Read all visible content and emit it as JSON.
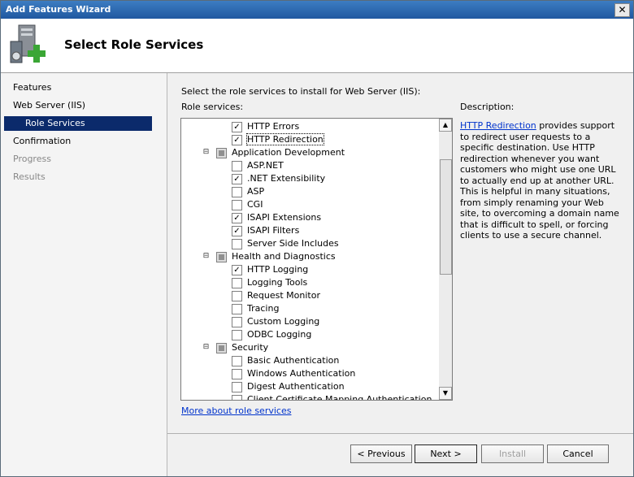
{
  "window": {
    "title": "Add Features Wizard",
    "close_label": "✕"
  },
  "header": {
    "title": "Select Role Services"
  },
  "nav": {
    "items": [
      {
        "label": "Features"
      },
      {
        "label": "Web Server (IIS)"
      },
      {
        "label": "Role Services"
      },
      {
        "label": "Confirmation"
      },
      {
        "label": "Progress"
      },
      {
        "label": "Results"
      }
    ]
  },
  "main": {
    "instruction": "Select the role services to install for Web Server (IIS):",
    "role_services_label": "Role services:",
    "description_label": "Description:",
    "description_link": "HTTP Redirection",
    "description_text": " provides support to redirect user requests to a specific destination. Use HTTP redirection whenever you want customers who might use one URL to actually end up at another URL. This is helpful in many situations, from simply renaming your Web site, to overcoming a domain name that is difficult to spell, or forcing clients to use a secure channel.",
    "more_link": "More about role services"
  },
  "tree": {
    "items": [
      {
        "label": "HTTP Errors",
        "checked": true
      },
      {
        "label": "HTTP Redirection",
        "checked": true
      },
      {
        "label": "Application Development",
        "group": true
      },
      {
        "label": "ASP.NET",
        "checked": false
      },
      {
        "label": ".NET Extensibility",
        "checked": true
      },
      {
        "label": "ASP",
        "checked": false
      },
      {
        "label": "CGI",
        "checked": false
      },
      {
        "label": "ISAPI Extensions",
        "checked": true
      },
      {
        "label": "ISAPI Filters",
        "checked": true
      },
      {
        "label": "Server Side Includes",
        "checked": false
      },
      {
        "label": "Health and Diagnostics",
        "group": true
      },
      {
        "label": "HTTP Logging",
        "checked": true
      },
      {
        "label": "Logging Tools",
        "checked": false
      },
      {
        "label": "Request Monitor",
        "checked": false
      },
      {
        "label": "Tracing",
        "checked": false
      },
      {
        "label": "Custom Logging",
        "checked": false
      },
      {
        "label": "ODBC Logging",
        "checked": false
      },
      {
        "label": "Security",
        "group": true
      },
      {
        "label": "Basic Authentication",
        "checked": false
      },
      {
        "label": "Windows Authentication",
        "checked": false
      },
      {
        "label": "Digest Authentication",
        "checked": false
      },
      {
        "label": "Client Certificate Mapping Authentication",
        "checked": false
      }
    ]
  },
  "buttons": {
    "previous": "< Previous",
    "next": "Next >",
    "install": "Install",
    "cancel": "Cancel"
  }
}
